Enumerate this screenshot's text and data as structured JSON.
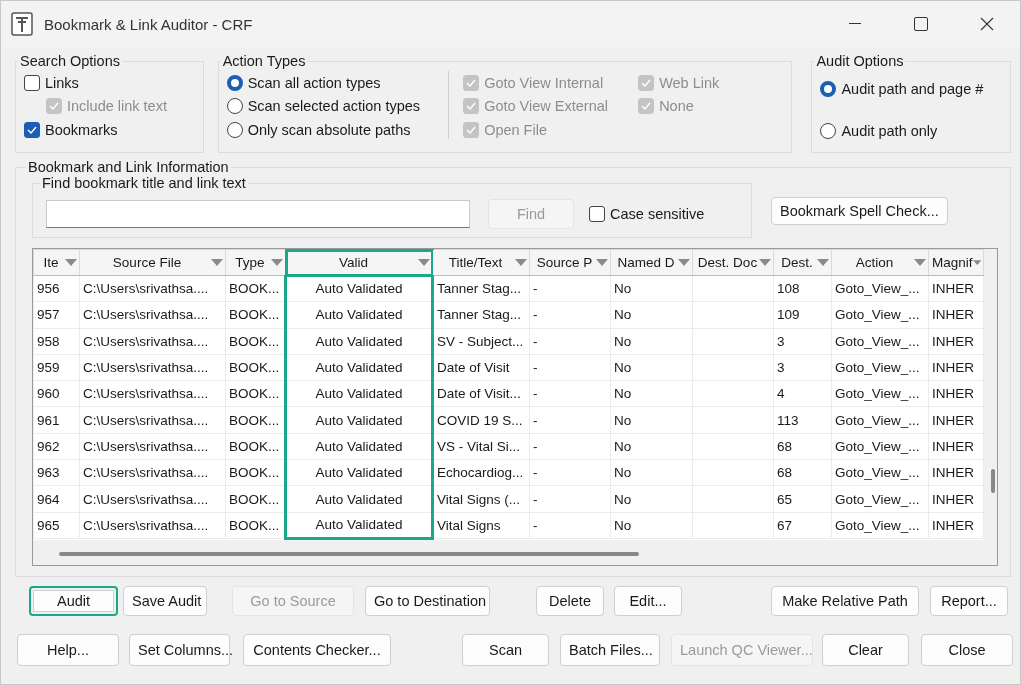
{
  "window": {
    "title": "Bookmark & Link Auditor - CRF"
  },
  "search_options": {
    "title": "Search Options",
    "items": [
      {
        "label": "Links",
        "checked": false,
        "disabled": false,
        "children": [
          {
            "label": "Include link text",
            "checked": true,
            "disabled": true
          }
        ]
      },
      {
        "label": "Bookmarks",
        "checked": true,
        "disabled": false
      }
    ]
  },
  "action_types": {
    "title": "Action Types",
    "radios": [
      {
        "label": "Scan all action types",
        "selected": true
      },
      {
        "label": "Scan selected action types",
        "selected": false
      },
      {
        "label": "Only scan absolute paths",
        "selected": false
      }
    ],
    "checkboxes": [
      {
        "label": "Goto View Internal",
        "checked": true,
        "disabled": true
      },
      {
        "label": "Goto View External",
        "checked": true,
        "disabled": true
      },
      {
        "label": "Open File",
        "checked": true,
        "disabled": true
      },
      {
        "label": "Web Link",
        "checked": true,
        "disabled": true
      },
      {
        "label": "None",
        "checked": true,
        "disabled": true
      }
    ]
  },
  "audit_options": {
    "title": "Audit Options",
    "radios": [
      {
        "label": "Audit path and page #",
        "selected": true
      },
      {
        "label": "Audit path only",
        "selected": false
      }
    ]
  },
  "info": {
    "title": "Bookmark and Link Information",
    "find": {
      "title": "Find bookmark title and link text",
      "find_button": {
        "label": "Find",
        "disabled": true
      },
      "case_sensitive": {
        "label": "Case sensitive",
        "checked": false
      }
    },
    "spell_check_button": {
      "label": "Bookmark Spell Check..."
    },
    "table": {
      "columns": [
        {
          "label": "Ite",
          "highlighted": false
        },
        {
          "label": "Source File",
          "highlighted": false
        },
        {
          "label": "Type",
          "highlighted": false
        },
        {
          "label": "Valid",
          "highlighted": true
        },
        {
          "label": "Title/Text",
          "highlighted": false
        },
        {
          "label": "Source P",
          "highlighted": false
        },
        {
          "label": "Named D",
          "highlighted": false
        },
        {
          "label": "Dest. Doc",
          "highlighted": false
        },
        {
          "label": "Dest.",
          "highlighted": false
        },
        {
          "label": "Action",
          "highlighted": false
        },
        {
          "label": "Magnif",
          "highlighted": false
        }
      ],
      "rows": [
        [
          "956",
          "C:\\Users\\srivathsa....",
          "BOOK...",
          "Auto Validated",
          "Tanner Stag...",
          "-",
          "No",
          "",
          "108",
          "Goto_View_...",
          "INHER"
        ],
        [
          "957",
          "C:\\Users\\srivathsa....",
          "BOOK...",
          "Auto Validated",
          "Tanner Stag...",
          "-",
          "No",
          "",
          "109",
          "Goto_View_...",
          "INHER"
        ],
        [
          "958",
          "C:\\Users\\srivathsa....",
          "BOOK...",
          "Auto Validated",
          "SV - Subject...",
          "-",
          "No",
          "",
          "3",
          "Goto_View_...",
          "INHER"
        ],
        [
          "959",
          "C:\\Users\\srivathsa....",
          "BOOK...",
          "Auto Validated",
          "Date of Visit",
          "-",
          "No",
          "",
          "3",
          "Goto_View_...",
          "INHER"
        ],
        [
          "960",
          "C:\\Users\\srivathsa....",
          "BOOK...",
          "Auto Validated",
          "Date of Visit...",
          "-",
          "No",
          "",
          "4",
          "Goto_View_...",
          "INHER"
        ],
        [
          "961",
          "C:\\Users\\srivathsa....",
          "BOOK...",
          "Auto Validated",
          "COVID 19 S...",
          "-",
          "No",
          "",
          "113",
          "Goto_View_...",
          "INHER"
        ],
        [
          "962",
          "C:\\Users\\srivathsa....",
          "BOOK...",
          "Auto Validated",
          "VS - Vital Si...",
          "-",
          "No",
          "",
          "68",
          "Goto_View_...",
          "INHER"
        ],
        [
          "963",
          "C:\\Users\\srivathsa....",
          "BOOK...",
          "Auto Validated",
          "Echocardiog...",
          "-",
          "No",
          "",
          "68",
          "Goto_View_...",
          "INHER"
        ],
        [
          "964",
          "C:\\Users\\srivathsa....",
          "BOOK...",
          "Auto Validated",
          "Vital Signs (...",
          "-",
          "No",
          "",
          "65",
          "Goto_View_...",
          "INHER"
        ],
        [
          "965",
          "C:\\Users\\srivathsa....",
          "BOOK...",
          "Auto Validated",
          "Vital Signs",
          "-",
          "No",
          "",
          "67",
          "Goto_View_...",
          "INHER"
        ]
      ]
    }
  },
  "button_rows": [
    [
      {
        "label": "Audit",
        "disabled": false,
        "highlighted": true
      },
      {
        "label": "Save Audit",
        "disabled": false,
        "highlighted": false
      },
      {
        "label": "Go to Source",
        "disabled": true,
        "highlighted": false
      },
      {
        "label": "Go to Destination",
        "disabled": false,
        "highlighted": false
      },
      {
        "label": "Delete",
        "disabled": false,
        "highlighted": false
      },
      {
        "label": "Edit...",
        "disabled": false,
        "highlighted": false
      },
      {
        "label": "Make Relative Path",
        "disabled": false,
        "highlighted": false
      },
      {
        "label": "Report...",
        "disabled": false,
        "highlighted": false
      }
    ],
    [
      {
        "label": "Help...",
        "disabled": false,
        "highlighted": false
      },
      {
        "label": "Set Columns...",
        "disabled": false,
        "highlighted": false
      },
      {
        "label": "Contents Checker...",
        "disabled": false,
        "highlighted": false
      },
      {
        "label": "Scan",
        "disabled": false,
        "highlighted": false
      },
      {
        "label": "Batch Files...",
        "disabled": false,
        "highlighted": false
      },
      {
        "label": "Launch QC Viewer...",
        "disabled": true,
        "highlighted": false
      },
      {
        "label": "Clear",
        "disabled": false,
        "highlighted": false
      },
      {
        "label": "Close",
        "disabled": false,
        "highlighted": false
      }
    ]
  ]
}
